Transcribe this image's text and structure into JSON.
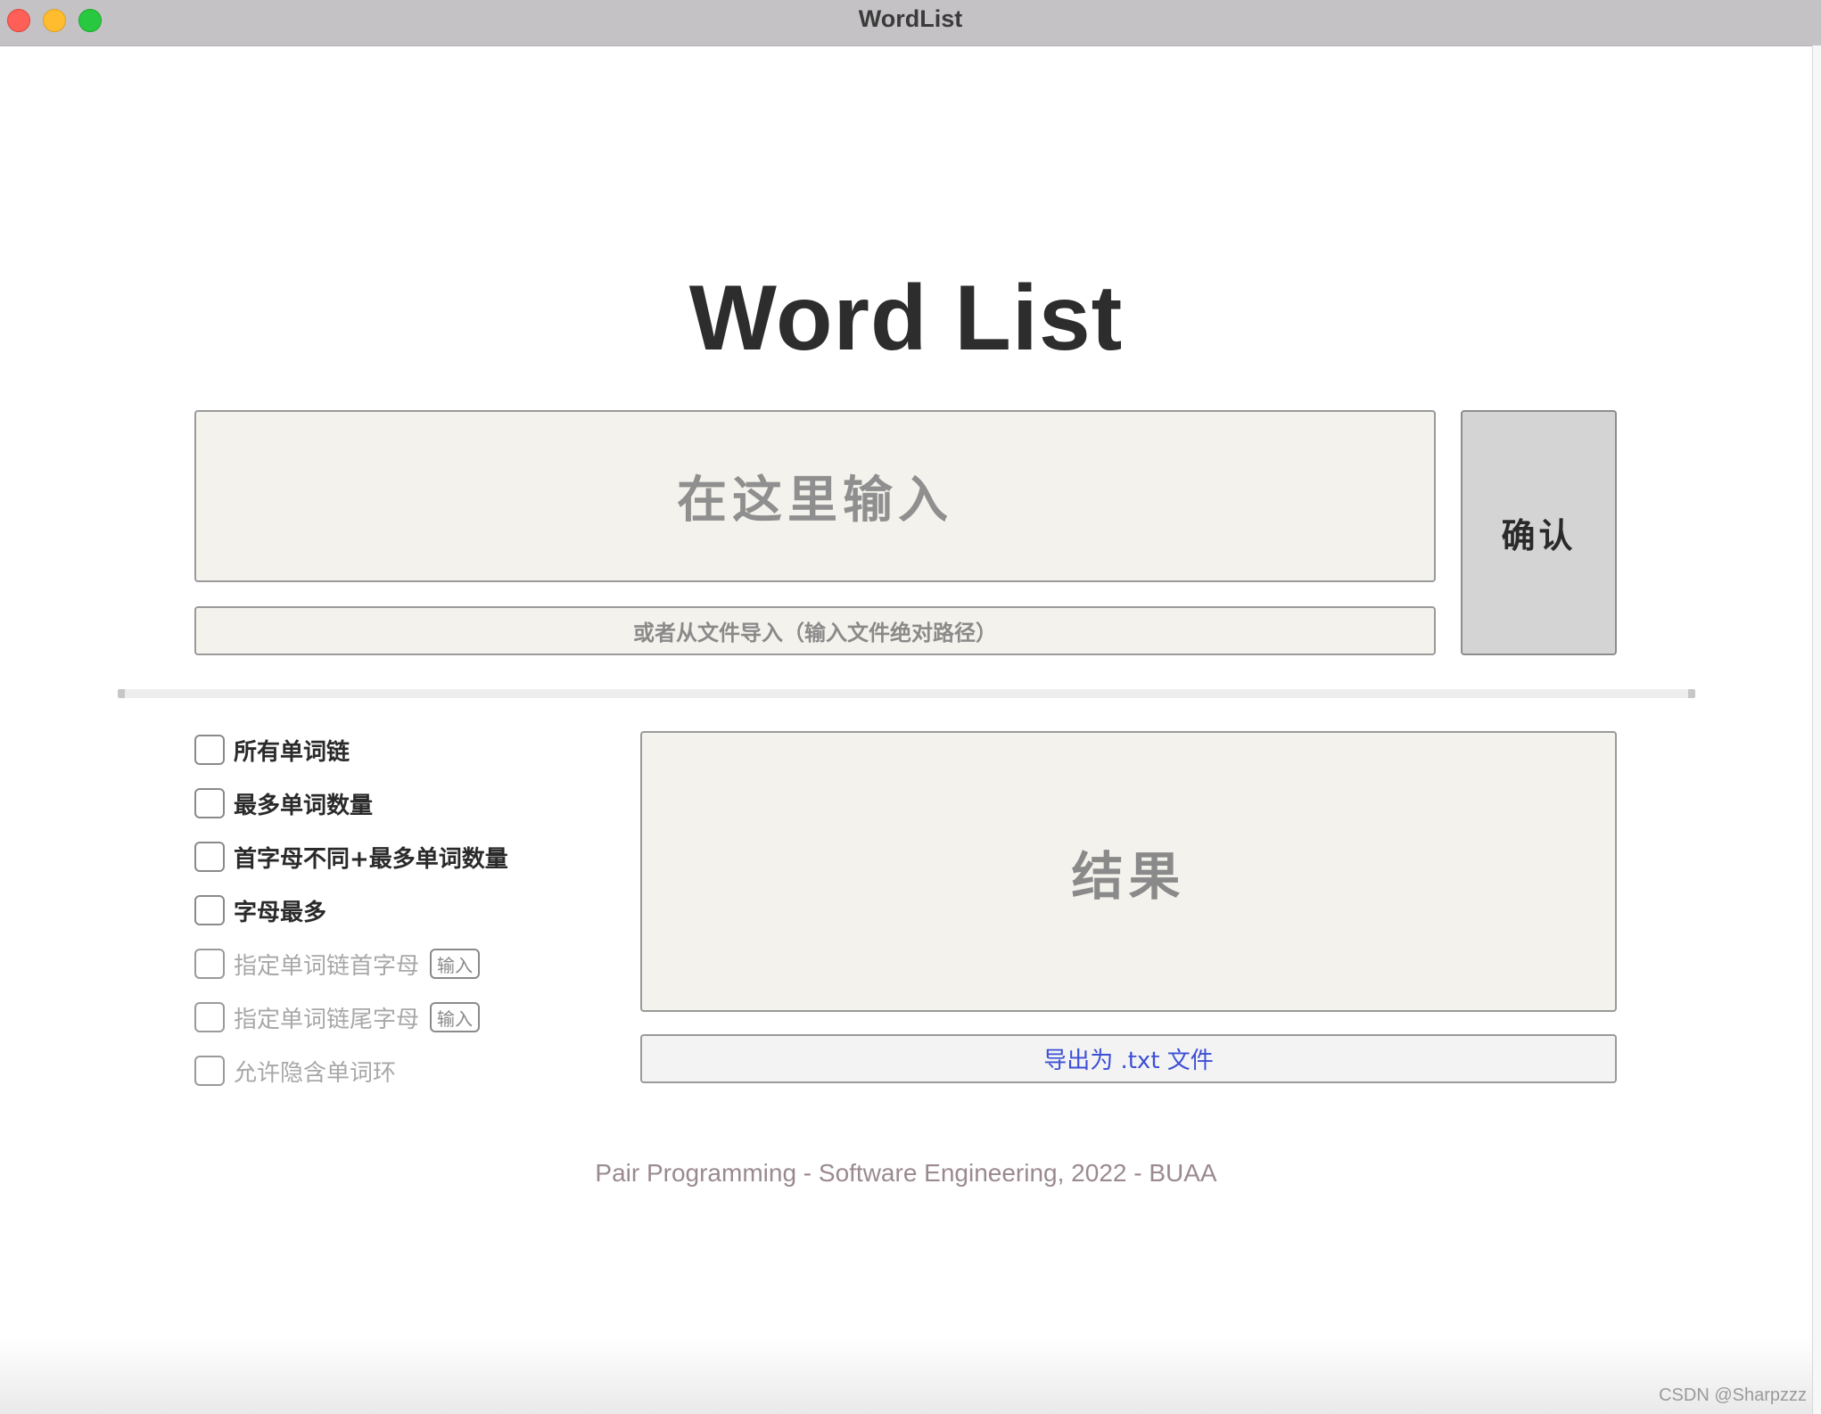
{
  "window": {
    "title": "WordList"
  },
  "main": {
    "heading": "Word List",
    "input_placeholder": "在这里输入",
    "file_input_placeholder": "或者从文件导入（输入文件绝对路径）",
    "confirm_label": "确认"
  },
  "options": [
    {
      "label": "所有单词链",
      "enabled": true,
      "has_input": false
    },
    {
      "label": "最多单词数量",
      "enabled": true,
      "has_input": false
    },
    {
      "label": "首字母不同+最多单词数量",
      "enabled": true,
      "has_input": false
    },
    {
      "label": "字母最多",
      "enabled": true,
      "has_input": false
    },
    {
      "label": "指定单词链首字母",
      "enabled": false,
      "has_input": true,
      "input_label": "输入"
    },
    {
      "label": "指定单词链尾字母",
      "enabled": false,
      "has_input": true,
      "input_label": "输入"
    },
    {
      "label": "允许隐含单词环",
      "enabled": false,
      "has_input": false
    }
  ],
  "result": {
    "placeholder": "结果",
    "export_label": "导出为 .txt 文件"
  },
  "footer": {
    "text": "Pair Programming - Software Engineering, 2022 - BUAA"
  },
  "watermark": "CSDN @Sharpzzz",
  "colors": {
    "titlebar": "#c4c2c4",
    "field_bg": "#f4f2ec",
    "confirm_bg": "#d4d4d4",
    "export_text": "#3d4fd6",
    "footer_text": "#9a8a8e"
  }
}
